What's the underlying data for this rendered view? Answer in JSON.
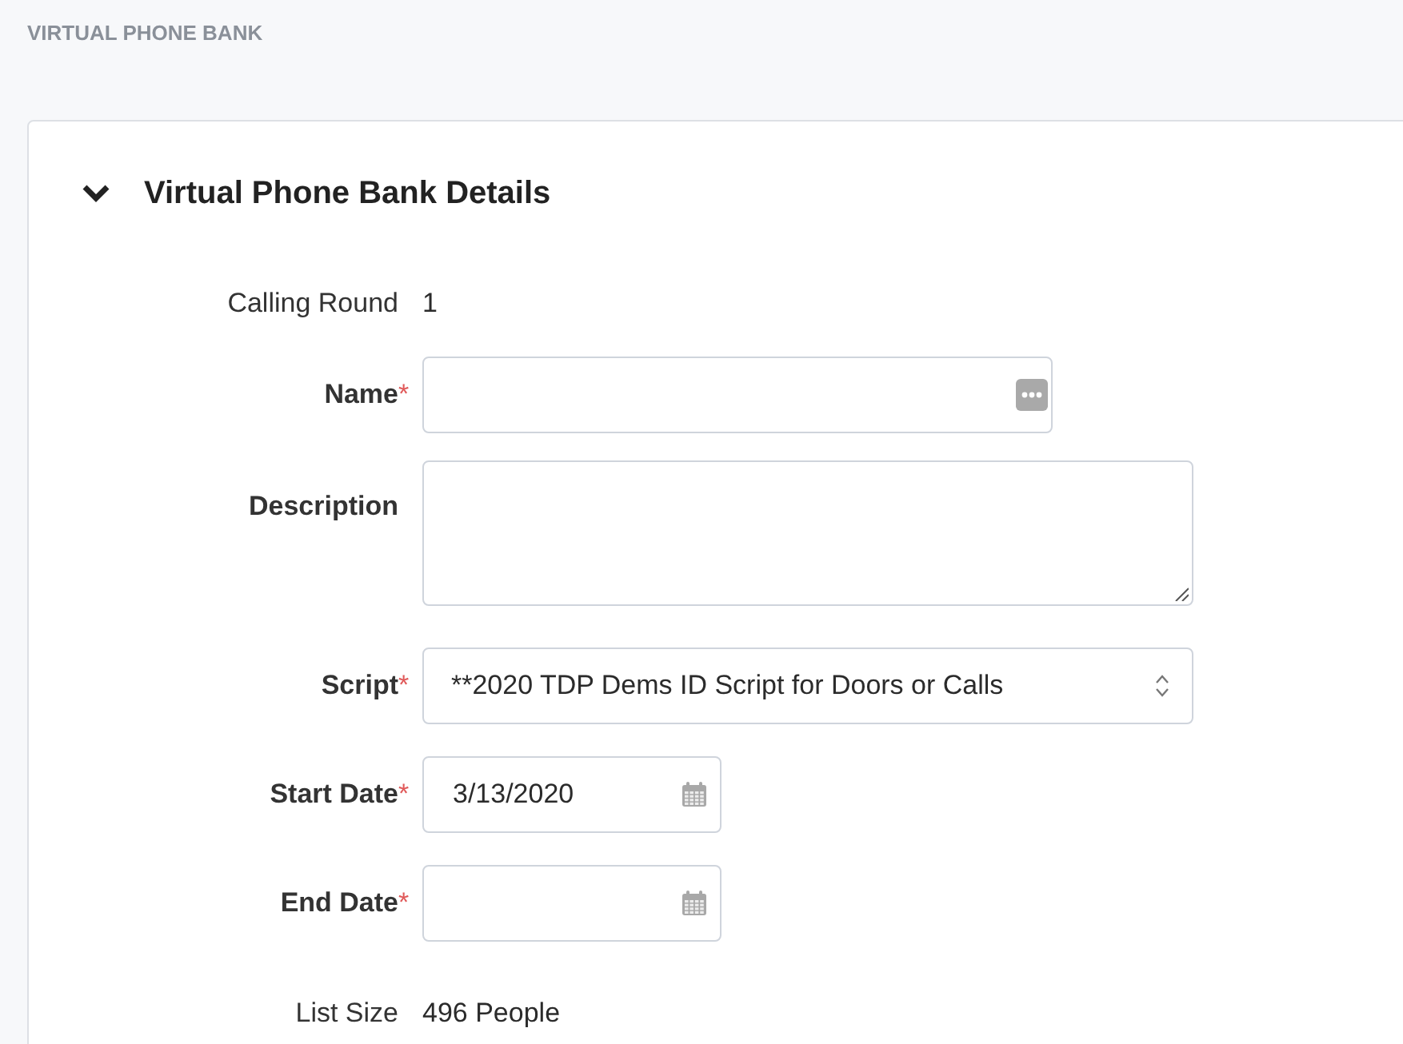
{
  "page_title": "VIRTUAL PHONE BANK",
  "section": {
    "title": "Virtual Phone Bank Details",
    "expanded": true,
    "fields": [
      {
        "kind": "static",
        "label": "Calling Round",
        "value": "1"
      },
      {
        "kind": "text",
        "label": "Name",
        "required_mark": "*"
      },
      {
        "kind": "textarea",
        "label": "Description"
      },
      {
        "kind": "select",
        "label": "Script",
        "required_mark": "*",
        "value": "**2020 TDP Dems ID Script for Doors or Calls"
      },
      {
        "kind": "date",
        "label": "Start Date",
        "required_mark": "*",
        "value": "3/13/2020"
      },
      {
        "kind": "date",
        "label": "End Date",
        "required_mark": "*"
      },
      {
        "kind": "static",
        "label": "List Size",
        "value": "496 People"
      }
    ]
  }
}
